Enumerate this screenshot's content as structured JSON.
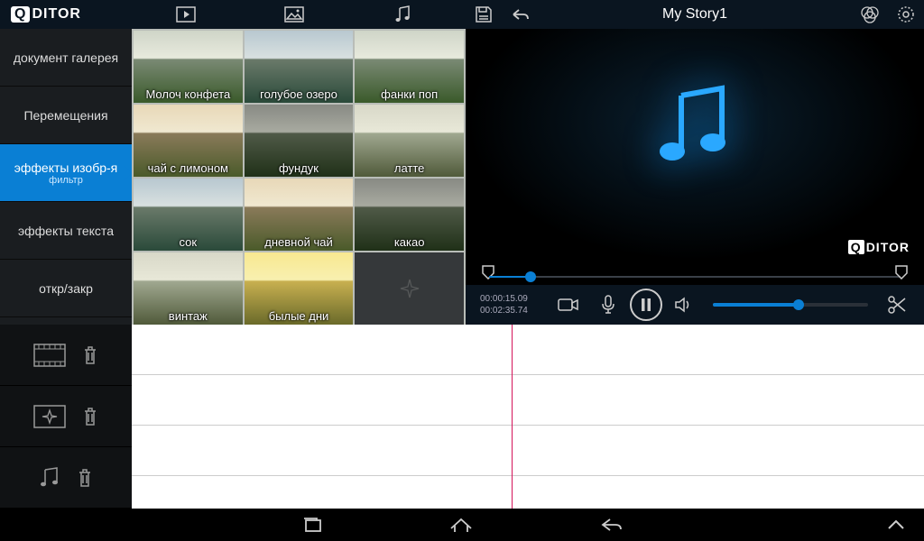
{
  "app": {
    "logo_prefix": "Q",
    "logo_rest": "DITOR"
  },
  "header": {
    "project_title": "My Story1"
  },
  "sidebar": {
    "items": [
      {
        "label": "документ галерея",
        "sub": ""
      },
      {
        "label": "Перемещения",
        "sub": ""
      },
      {
        "label": "эффекты изобр-я",
        "sub": "фильтр"
      },
      {
        "label": "эффекты текста",
        "sub": ""
      },
      {
        "label": "откр/закр",
        "sub": ""
      }
    ],
    "active_index": 2
  },
  "filters": [
    {
      "label": "Молоч конфета",
      "tone": ""
    },
    {
      "label": "голубое озеро",
      "tone": "tone-blue"
    },
    {
      "label": "фанки поп",
      "tone": ""
    },
    {
      "label": "чай с лимоном",
      "tone": "tone-warm"
    },
    {
      "label": "фундук",
      "tone": "tone-dark"
    },
    {
      "label": "латте",
      "tone": "tone-soft"
    },
    {
      "label": "сок",
      "tone": "tone-blue"
    },
    {
      "label": "дневной чай",
      "tone": "tone-warm"
    },
    {
      "label": "какао",
      "tone": "tone-dark"
    },
    {
      "label": "винтаж",
      "tone": "tone-soft"
    },
    {
      "label": "былые дни",
      "tone": "tone-yellow"
    }
  ],
  "preview": {
    "watermark_prefix": "Q",
    "watermark_rest": "DITOR"
  },
  "playback": {
    "current_time": "00:00:15.09",
    "total_time": "00:02:35.74",
    "scrub_percent": 9,
    "volume_percent": 55
  }
}
